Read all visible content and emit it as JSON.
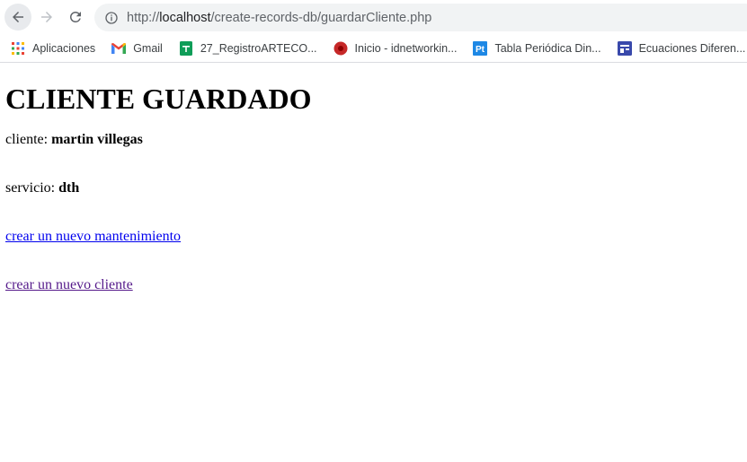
{
  "browser": {
    "url_scheme": "http://",
    "url_host": "localhost",
    "url_path": "/create-records-db/guardarCliente.php",
    "bookmarks": [
      {
        "label": "Aplicaciones",
        "icon": "apps-grid-icon"
      },
      {
        "label": "Gmail",
        "icon": "gmail-icon"
      },
      {
        "label": "27_RegistroARTECO...",
        "icon": "sheets-icon"
      },
      {
        "label": "Inicio - idnetworkin...",
        "icon": "red-circle-icon"
      },
      {
        "label": "Tabla Periódica Din...",
        "icon": "pt-icon"
      },
      {
        "label": "Ecuaciones Diferen...",
        "icon": "blue-doc-icon"
      },
      {
        "label": "",
        "icon": "github-icon"
      }
    ]
  },
  "page": {
    "heading": "CLIENTE GUARDADO",
    "cliente_label": "cliente:",
    "cliente_value": "martin villegas",
    "servicio_label": "servicio:",
    "servicio_value": "dth",
    "link_mantenimiento": "crear un nuevo mantenimiento",
    "link_cliente": "crear un nuevo cliente"
  }
}
